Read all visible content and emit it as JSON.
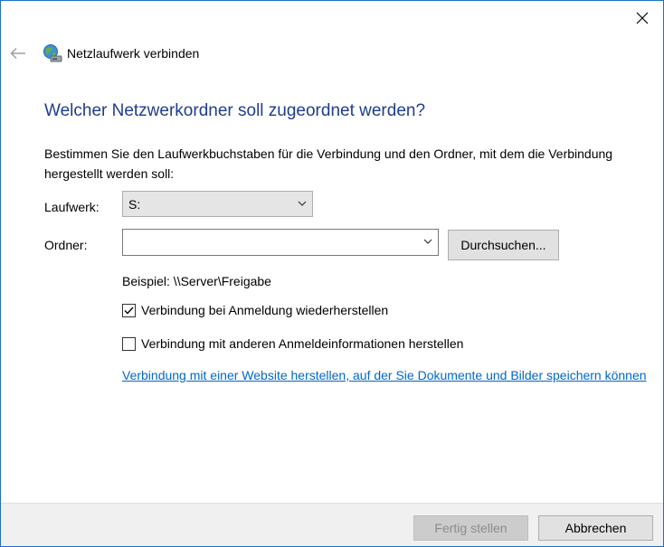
{
  "window": {
    "close_icon": "close-icon"
  },
  "header": {
    "back_icon": "back-arrow-icon",
    "app_icon": "network-drive-icon",
    "title": "Netzlaufwerk verbinden"
  },
  "main": {
    "heading": "Welcher Netzwerkordner soll zugeordnet werden?",
    "description": "Bestimmen Sie den Laufwerkbuchstaben für die Verbindung und den Ordner, mit dem die Verbindung hergestellt werden soll:",
    "drive_label": "Laufwerk:",
    "drive_value": "S:",
    "folder_label": "Ordner:",
    "folder_value": "",
    "browse_button": "Durchsuchen...",
    "example": "Beispiel: \\\\Server\\Freigabe",
    "reconnect_checkbox": {
      "label": "Verbindung bei Anmeldung wiederherstellen",
      "checked": true
    },
    "credentials_checkbox": {
      "label": "Verbindung mit anderen Anmeldeinformationen herstellen",
      "checked": false
    },
    "website_link": "Verbindung mit einer Website herstellen, auf der Sie Dokumente und Bilder speichern können"
  },
  "footer": {
    "finish_button": "Fertig stellen",
    "cancel_button": "Abbrechen"
  },
  "colors": {
    "heading": "#1e3d8f",
    "link": "#0066cc",
    "window_border": "#1a73c8"
  }
}
